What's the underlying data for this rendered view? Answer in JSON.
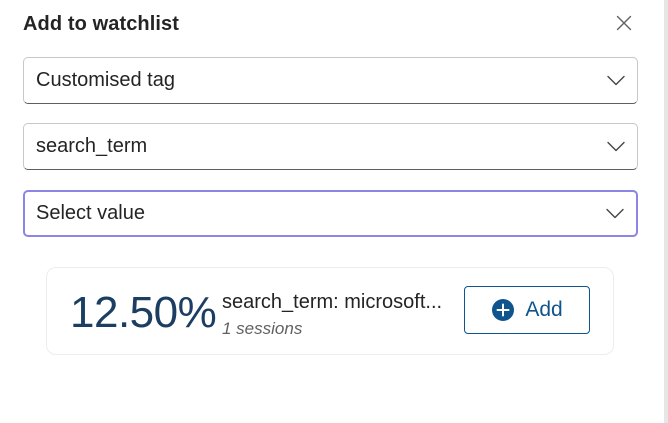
{
  "dialog": {
    "title": "Add to watchlist",
    "close_icon": "close-icon"
  },
  "selects": [
    {
      "value": "Customised tag",
      "icon": "chevron-down-icon"
    },
    {
      "value": "search_term",
      "icon": "chevron-down-icon"
    },
    {
      "placeholder": "Select value",
      "icon": "chevron-down-icon",
      "focused": true
    }
  ],
  "result": {
    "percentage": "12.50%",
    "term": "search_term: microsoft...",
    "sessions": "1 sessions",
    "add_label": "Add",
    "add_icon": "plus-circle-icon"
  },
  "colors": {
    "accent": "#0f548c",
    "percentage": "#1c3e63",
    "focus_border": "#8b85e6"
  }
}
